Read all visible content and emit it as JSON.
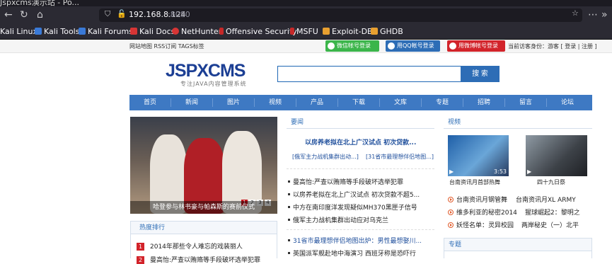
{
  "browser": {
    "tab_title": "Jspxcms演示站 - Po...",
    "url_host": "192.168.8.124",
    "url_port": ":8080",
    "bookmarks": [
      "Kali Linux",
      "Kali Tools",
      "Kali Forums",
      "Kali Docs",
      "NetHunter",
      "Offensive Security",
      "MSFU",
      "Exploit-DB",
      "GHDB"
    ]
  },
  "topbar": {
    "links": "网站地图 RSS订阅 TAGS标签",
    "wechat_login": "微信帐号登录",
    "qq_login": "用QQ帐号登录",
    "weibo_login": "用微博帐号登录",
    "identity": "当前访客身份：游客 [ 登录 | 注册 ]"
  },
  "header": {
    "logo": "JSPXCMS",
    "tagline": "专注JAVA内容管理系统",
    "search_placeholder": "",
    "search_button": "搜 索"
  },
  "nav": [
    "首页",
    "新闻",
    "图片",
    "视频",
    "产品",
    "下载",
    "文库",
    "专题",
    "招聘",
    "留言",
    "论坛"
  ],
  "slideshow": {
    "caption": "哈登参与林书豪与帕森斯的赛前仪式",
    "pages": [
      "1",
      "2",
      "3",
      "4"
    ]
  },
  "hot": {
    "title": "热度排行",
    "items": [
      "2014年那些令人难忘的戏装丽人",
      "曼高怡:严查以贿赂等手段破坏选举犯罪"
    ]
  },
  "news": {
    "title": "要闻",
    "headline": "以房养老拟在北上广汉试点 初次贷款...",
    "sub1": "[俄军主力战机集群出动...]",
    "sub2": "[31省市最理想伴侣地图...]",
    "list": [
      "曼高怡:严查以贿赂等手段破坏选举犯罪",
      "以房养老拟在北上广汉试点 初次贷款不超5...",
      "中方在南印度洋发现疑似MH370黑匣子信号",
      "俄军主力战机集群出动应对乌克兰",
      "31省市最理想伴侣地图出炉：男性最想娶川...",
      "英国派军舰赴地中海演习 西班牙称是恐吓行"
    ]
  },
  "video": {
    "title": "视频",
    "thumb1_caption": "台南资讯月首部热舞",
    "thumb1_time": "3:53",
    "thumb2_caption": "四十九日祭",
    "list": [
      [
        "台南资讯月钢管舞",
        "台南资讯月XL ARMY"
      ],
      [
        "维多利亚的秘密2014",
        "猩球崛起2：黎明之"
      ],
      [
        "妖怪名单：灵异校园",
        "两岸秘史（一）北平"
      ]
    ]
  },
  "topic": {
    "title": "专题"
  }
}
